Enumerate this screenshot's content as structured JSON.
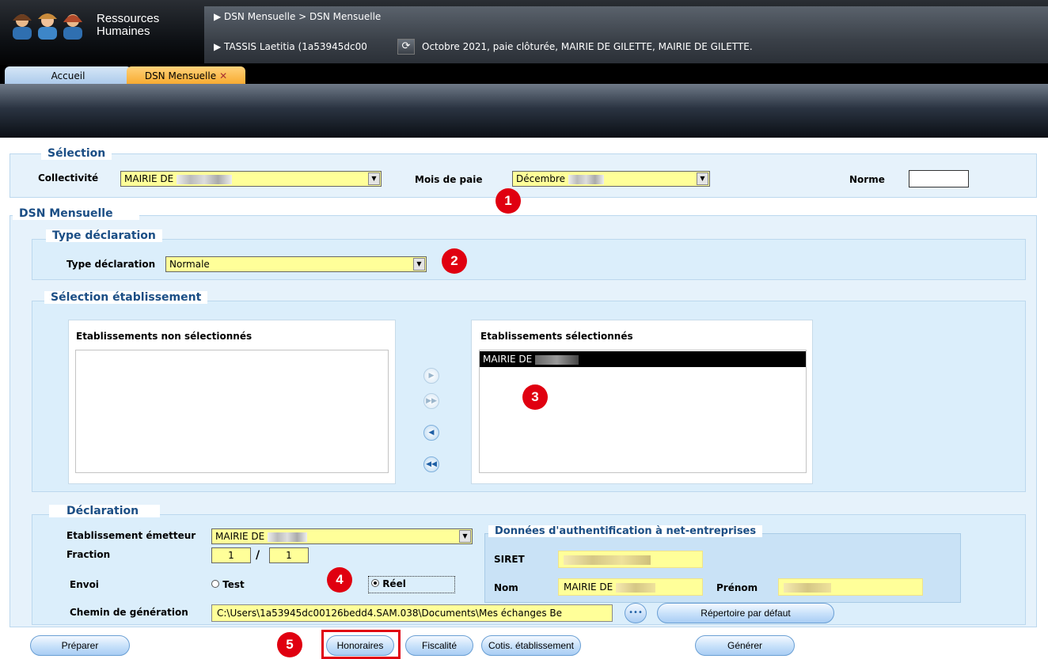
{
  "app": {
    "title_line1": "Ressources",
    "title_line2": "Humaines"
  },
  "breadcrumb": {
    "path": "▶ DSN Mensuelle > DSN Mensuelle",
    "user": "▶ TASSIS Laetitia (1a53945dc00",
    "context": "Octobre 2021, paie clôturée, MAIRIE DE GILETTE, MAIRIE DE GILETTE."
  },
  "tabs": [
    {
      "label": "Accueil"
    },
    {
      "label": "DSN Mensuelle",
      "close": "✕"
    }
  ],
  "selection": {
    "legend": "Sélection",
    "collectivite_label": "Collectivité",
    "collectivite_value": "MAIRIE DE",
    "mois_label": "Mois de paie",
    "mois_value": "Décembre",
    "norme_label": "Norme",
    "norme_value": ""
  },
  "dsn": {
    "legend": "DSN Mensuelle",
    "type": {
      "legend": "Type déclaration",
      "label": "Type déclaration",
      "value": "Normale"
    },
    "etab": {
      "legend": "Sélection établissement",
      "non_sel_title": "Etablissements non sélectionnés",
      "sel_title": "Etablissements sélectionnés",
      "selected_items": [
        "MAIRIE DE"
      ]
    },
    "declaration": {
      "legend": "Déclaration",
      "emetteur_label": "Etablissement émetteur",
      "emetteur_value": "MAIRIE DE",
      "fraction_label": "Fraction",
      "fraction_num": "1",
      "fraction_sep": "/",
      "fraction_den": "1",
      "envoi_label": "Envoi",
      "envoi_test": "Test",
      "envoi_reel": "Réel",
      "envoi_selected": "Réel",
      "chemin_label": "Chemin de génération",
      "chemin_value": "C:\\Users\\1a53945dc00126bedd4.SAM.038\\Documents\\Mes échanges Be",
      "browse": "•••",
      "default_dir": "Répertoire par défaut",
      "auth": {
        "legend": "Données d'authentification à net-entreprises",
        "siret_label": "SIRET",
        "nom_label": "Nom",
        "nom_value": "MAIRIE DE",
        "prenom_label": "Prénom"
      }
    }
  },
  "buttons": {
    "preparer": "Préparer",
    "honoraires": "Honoraires",
    "fiscalite": "Fiscalité",
    "cotis": "Cotis. établissement",
    "generer": "Générer"
  },
  "badges": [
    "1",
    "2",
    "3",
    "4",
    "5"
  ],
  "colors": {
    "accent": "#1b4e85",
    "field_yellow": "#ffff99",
    "badge_red": "#e00010",
    "group_bg": "#e6f2fb"
  },
  "icons": {
    "refresh": "refresh-icon",
    "nav": [
      "move-right-icon",
      "move-all-right-icon",
      "move-left-icon",
      "move-all-left-icon"
    ]
  }
}
